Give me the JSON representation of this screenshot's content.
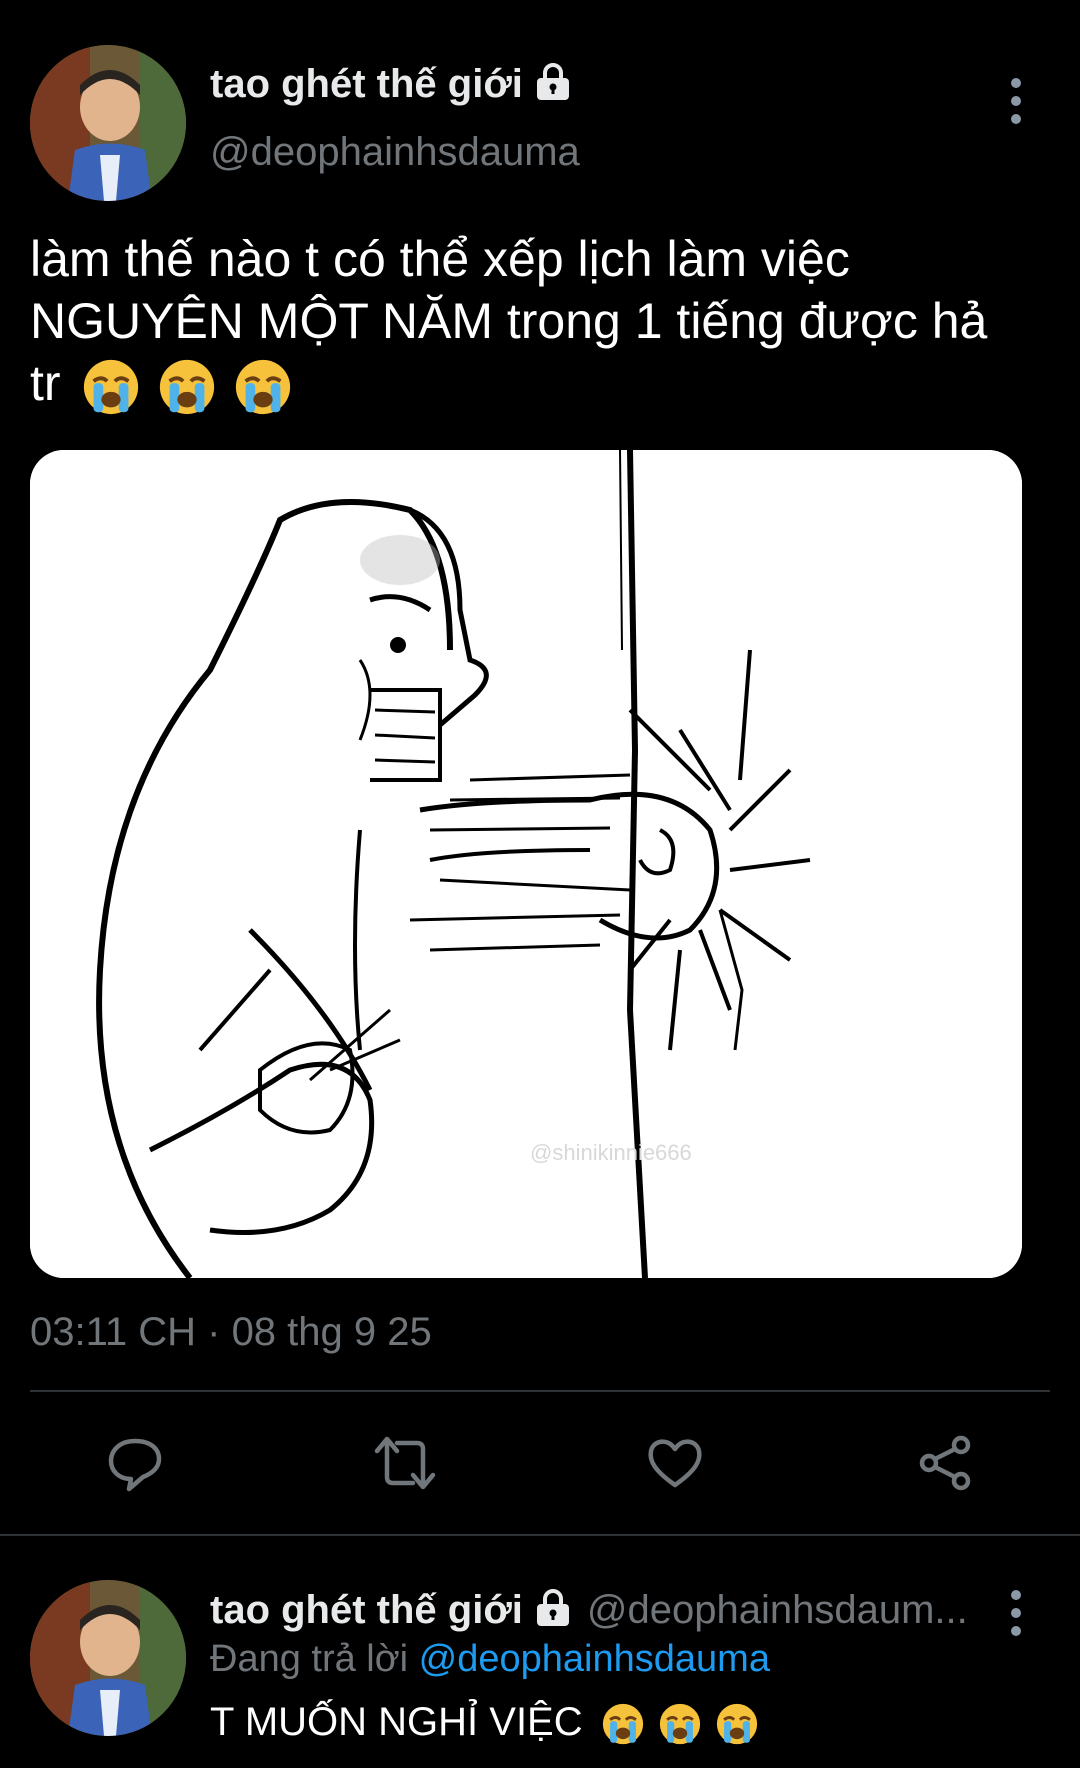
{
  "tweet": {
    "display_name": "tao ghét thế giới",
    "handle": "@deophainhsdauma",
    "text_line1": "làm thế nào t có thể xếp lịch làm việc",
    "text_line2": "NGUYÊN MỘT NĂM trong 1 tiếng được hả",
    "text_line3": "tr",
    "emoji_count": 3,
    "image_watermark": "@shinikinnie666",
    "timestamp": "03:11 CH · 08 thg 9 25"
  },
  "actions": [
    "reply-icon",
    "retweet-icon",
    "like-icon",
    "share-icon"
  ],
  "reply": {
    "display_name": "tao ghét thế giới",
    "handle": "@deophainhsdaum...",
    "replying_label": "Đang trả lời",
    "replying_to": "@deophainhsdauma",
    "text": "T MUỐN NGHỈ VIỆC"
  },
  "colors": {
    "background": "#000000",
    "text": "#e7e9ea",
    "secondary": "#71767b",
    "accent": "#1d9bf0",
    "divider": "#2f3336"
  }
}
